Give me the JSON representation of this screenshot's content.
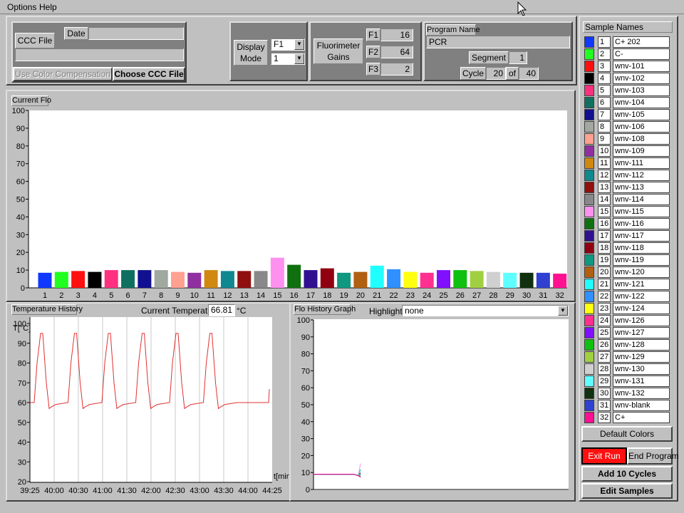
{
  "menu": {
    "options": "Options",
    "help": "Help"
  },
  "ccc": {
    "file_label": "CCC File",
    "date_label": "Date",
    "date_value": "",
    "file_value": "",
    "use_color_comp": "Use Color Compensation",
    "choose_button": "Choose CCC File"
  },
  "display": {
    "label_line1": "Display",
    "label_line2": "Mode",
    "mode_value": "F1",
    "channel_value": "1"
  },
  "gains": {
    "label_line1": "Fluorimeter",
    "label_line2": "Gains",
    "items": [
      {
        "name": "F1",
        "value": "16"
      },
      {
        "name": "F2",
        "value": "64"
      },
      {
        "name": "F3",
        "value": "2"
      }
    ]
  },
  "program": {
    "name_label": "Program Name",
    "name_value": "PCR",
    "segment_label": "Segment",
    "segment_value": "1",
    "cycle_label": "Cycle",
    "cycle_value": "20",
    "of_label": "of",
    "cycle_total": "40"
  },
  "current_flo": {
    "tab_label": "Current Flo",
    "chart_data": {
      "type": "bar",
      "ylim": [
        0,
        100
      ],
      "yticks": [
        "100",
        "90",
        "80",
        "70",
        "60",
        "50",
        "40",
        "30",
        "20",
        "10",
        "0"
      ],
      "categories": [
        "1",
        "2",
        "3",
        "4",
        "5",
        "6",
        "7",
        "8",
        "9",
        "10",
        "11",
        "12",
        "13",
        "14",
        "15",
        "16",
        "17",
        "18",
        "19",
        "20",
        "21",
        "22",
        "23",
        "24",
        "25",
        "26",
        "27",
        "28",
        "29",
        "30",
        "31",
        "32"
      ],
      "values": [
        8.5,
        9,
        9.5,
        9,
        10,
        10,
        10,
        10,
        9,
        8.5,
        10,
        9.5,
        9.5,
        9.5,
        17,
        13,
        10,
        11,
        8.5,
        9,
        12.5,
        10.5,
        9,
        8.5,
        10,
        10,
        9.5,
        9,
        8.5,
        8.5,
        8.5,
        8
      ]
    }
  },
  "temperature": {
    "tab_label": "Temperature History",
    "current_label": "Current Temperature",
    "current_value": "66.81",
    "unit": "°C",
    "ylabel": "T[°C]",
    "xlabel": "t[min]",
    "chart_data": {
      "type": "line",
      "ylim": [
        20,
        100
      ],
      "yticks": [
        "100",
        "90",
        "80",
        "70",
        "60",
        "50",
        "40",
        "30",
        "20"
      ],
      "xticks": [
        "39:25",
        "40:00",
        "40:30",
        "41:00",
        "41:30",
        "42:00",
        "42:30",
        "43:00",
        "43:30",
        "44:00",
        "44:25"
      ],
      "series": [
        {
          "color": "#e03030",
          "peaks": 6,
          "baseline": 60,
          "peak": 95,
          "dip": 57,
          "end_value": 66.81
        }
      ]
    }
  },
  "flo_history": {
    "tab_label": "Flo History Graph",
    "highlight_label": "Highlight:",
    "highlight_value": "none",
    "chart_data": {
      "type": "line",
      "ylim": [
        0,
        100
      ],
      "yticks": [
        "100",
        "90",
        "80",
        "70",
        "60",
        "50",
        "40",
        "30",
        "20",
        "10",
        "0"
      ]
    }
  },
  "samples": {
    "header": "Sample Names",
    "items": [
      {
        "num": "1",
        "name": "C+ 202",
        "color": "#1038ff"
      },
      {
        "num": "2",
        "name": "C-",
        "color": "#20ff20"
      },
      {
        "num": "3",
        "name": "wnv-101",
        "color": "#ff1010"
      },
      {
        "num": "4",
        "name": "wnv-102",
        "color": "#000000"
      },
      {
        "num": "5",
        "name": "wnv-103",
        "color": "#ff3080"
      },
      {
        "num": "6",
        "name": "wnv-104",
        "color": "#107060"
      },
      {
        "num": "7",
        "name": "wnv-105",
        "color": "#101090"
      },
      {
        "num": "8",
        "name": "wnv-106",
        "color": "#a0a8a0"
      },
      {
        "num": "9",
        "name": "wnv-108",
        "color": "#ffa090"
      },
      {
        "num": "10",
        "name": "wnv-109",
        "color": "#9030a0"
      },
      {
        "num": "11",
        "name": "wnv-111",
        "color": "#d08810"
      },
      {
        "num": "12",
        "name": "wnv-112",
        "color": "#108890"
      },
      {
        "num": "13",
        "name": "wnv-113",
        "color": "#901010"
      },
      {
        "num": "14",
        "name": "wnv-114",
        "color": "#888888"
      },
      {
        "num": "15",
        "name": "wnv-115",
        "color": "#ff90f0"
      },
      {
        "num": "16",
        "name": "wnv-116",
        "color": "#107010"
      },
      {
        "num": "17",
        "name": "wnv-117",
        "color": "#301090"
      },
      {
        "num": "18",
        "name": "wnv-118",
        "color": "#900010"
      },
      {
        "num": "19",
        "name": "wnv-119",
        "color": "#109880"
      },
      {
        "num": "20",
        "name": "wnv-120",
        "color": "#b06010"
      },
      {
        "num": "21",
        "name": "wnv-121",
        "color": "#20ffff"
      },
      {
        "num": "22",
        "name": "wnv-122",
        "color": "#3090ff"
      },
      {
        "num": "23",
        "name": "wnv-124",
        "color": "#ffff10"
      },
      {
        "num": "24",
        "name": "wnv-126",
        "color": "#ff3090"
      },
      {
        "num": "25",
        "name": "wnv-127",
        "color": "#8010ff"
      },
      {
        "num": "26",
        "name": "wnv-128",
        "color": "#10c010"
      },
      {
        "num": "27",
        "name": "wnv-129",
        "color": "#a0d040"
      },
      {
        "num": "28",
        "name": "wnv-130",
        "color": "#d0d0d0"
      },
      {
        "num": "29",
        "name": "wnv-131",
        "color": "#60ffff"
      },
      {
        "num": "30",
        "name": "wnv-132",
        "color": "#103010"
      },
      {
        "num": "31",
        "name": "wnv-blank",
        "color": "#3040d0"
      },
      {
        "num": "32",
        "name": "C+",
        "color": "#ff1090"
      }
    ]
  },
  "buttons": {
    "default_colors": "Default Colors",
    "exit_run": "Exit Run",
    "end_program": "End Program",
    "add_cycles": "Add 10 Cycles",
    "edit_samples": "Edit Samples"
  }
}
